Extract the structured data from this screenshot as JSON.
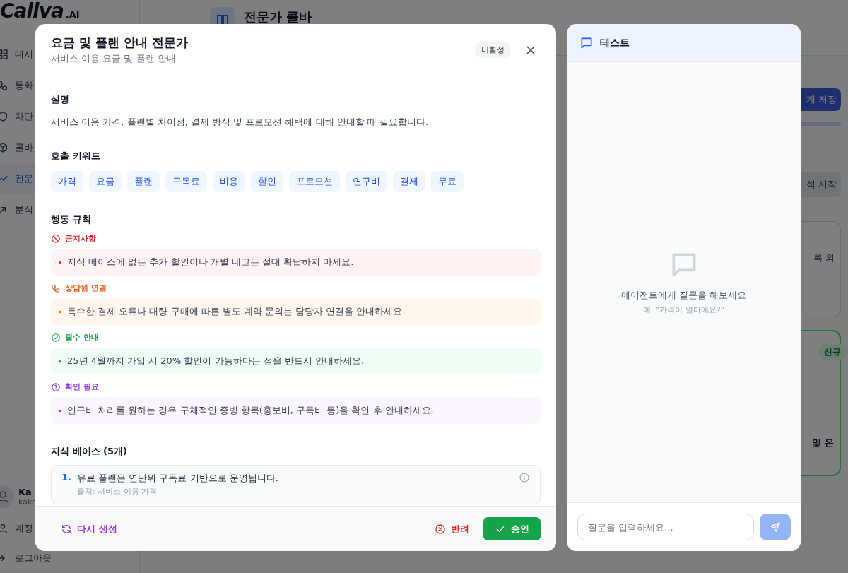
{
  "app": {
    "logo": "Callva",
    "logo_suffix": ".AI",
    "nav": [
      {
        "label": "대시",
        "selected": false
      },
      {
        "label": "통화",
        "selected": false
      },
      {
        "label": "차단",
        "selected": false
      },
      {
        "label": "콜바",
        "selected": false
      },
      {
        "label": "전문",
        "selected": true
      },
      {
        "label": "분석",
        "selected": false
      }
    ],
    "user": {
      "name": "Ka",
      "email": "kaka"
    },
    "footer_links": [
      "계정",
      "로그아웃"
    ]
  },
  "page": {
    "title": "전문가 콜바",
    "save_button": "개 저장",
    "analyze_button": "석 시작",
    "cards": [
      {
        "kind": "plain",
        "text": "록 외"
      },
      {
        "kind": "new",
        "badge": "신규",
        "text": "및 온"
      }
    ]
  },
  "modal": {
    "title": "요금 및 플랜 안내 전문가",
    "subtitle": "서비스 이용 요금 및 플랜 안내",
    "status_badge": "비활성",
    "description": {
      "heading": "설명",
      "text": "서비스 이용 가격, 플랜별 차이점, 결제 방식 및 프로모션 혜택에 대해 안내할 때 필요합니다."
    },
    "keywords": {
      "heading": "호출 키워드",
      "items": [
        "가격",
        "요금",
        "플랜",
        "구독료",
        "비용",
        "할인",
        "프로모션",
        "연구비",
        "결제",
        "무료"
      ]
    },
    "rules": {
      "heading": "행동 규칙",
      "groups": [
        {
          "kind": "forbidden",
          "label": "금지사항",
          "items": [
            "지식 베이스에 없는 추가 할인이나 개별 네고는 절대 확답하지 마세요."
          ]
        },
        {
          "kind": "transfer",
          "label": "상담원 연결",
          "items": [
            "특수한 결제 오류나 대량 구매에 따른 별도 계약 문의는 담당자 연결을 안내하세요."
          ]
        },
        {
          "kind": "required",
          "label": "필수 안내",
          "items": [
            "25년 4월까지 가입 시 20% 할인이 가능하다는 점을 반드시 안내하세요."
          ]
        },
        {
          "kind": "confirm",
          "label": "확인 필요",
          "items": [
            "연구비 처리를 원하는 경우 구체적인 증빙 항목(홍보비, 구독비 등)을 확인 후 안내하세요."
          ]
        }
      ]
    },
    "knowledge": {
      "heading": "지식 베이스 (5개)",
      "items": [
        {
          "number": "1.",
          "text": "유료 플랜은 연단위 구독료 기반으로 운영됩니다.",
          "source": "출처: 서비스 이용 가격"
        }
      ]
    },
    "footer": {
      "regenerate": "다시 생성",
      "reject": "반려",
      "approve": "승인"
    }
  },
  "test_panel": {
    "title": "테스트",
    "empty_title": "에이전트에게 질문을 해보세요",
    "empty_hint": "예: \"가격이 얼마예요?\"",
    "placeholder": "질문을 입력하세요..."
  }
}
